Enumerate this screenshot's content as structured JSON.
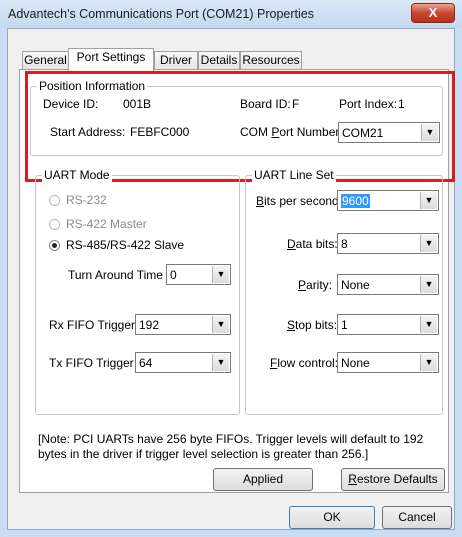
{
  "window": {
    "title": "Advantech's Communications Port (COM21) Properties",
    "close_glyph": "X",
    "close_color": "#c8462f"
  },
  "tabs": [
    "General",
    "Port Settings",
    "Driver",
    "Details",
    "Resources"
  ],
  "active_tab": "Port Settings",
  "position_info": {
    "legend": "Position Information",
    "device_id_label": "Device ID:",
    "device_id_value": "001B",
    "board_id_label": "Board ID:",
    "board_id_value": "F",
    "port_index_label": "Port Index:",
    "port_index_value": "1",
    "start_address_label": "Start Address:",
    "start_address_value": "FEBFC000",
    "com_port_label_pre": "COM ",
    "com_port_label_u": "P",
    "com_port_label_post": "ort Number:",
    "com_port_value": "COM21"
  },
  "uart_mode": {
    "legend": "UART Mode",
    "radio_rs232": "RS-232",
    "radio_rs422": "RS-422 Master",
    "radio_rs485": "RS-485/RS-422 Slave",
    "selected": "RS-485/RS-422 Slave",
    "turn_around_label": "Turn Around Time",
    "turn_around_value": "0",
    "rx_label": "Rx FIFO Trigger",
    "rx_value": "192",
    "tx_label": "Tx FIFO Trigger",
    "tx_value": "64"
  },
  "uart_line": {
    "legend": "UART Line Set",
    "bits_label_u": "B",
    "bits_label_rest": "its per second:",
    "bits_value": "9600",
    "data_label_u": "D",
    "data_label_rest": "ata bits:",
    "data_value": "8",
    "parity_label_u": "P",
    "parity_label_rest": "arity:",
    "parity_value": "None",
    "stop_label_u": "S",
    "stop_label_rest": "top bits:",
    "stop_value": "1",
    "flow_label_u": "F",
    "flow_label_rest": "low control:",
    "flow_value": "None"
  },
  "note": "[Note: PCI UARTs have 256 byte FIFOs. Trigger levels will default to 192 bytes in the driver if trigger level selection is greater than 256.]",
  "buttons": {
    "applied": "Applied",
    "restore_u": "R",
    "restore_rest": "estore Defaults",
    "ok": "OK",
    "cancel": "Cancel"
  },
  "icons": {
    "dropdown": "chevron-down-icon"
  },
  "colors": {
    "highlight": "#d62020",
    "selection": "#3399ff"
  }
}
